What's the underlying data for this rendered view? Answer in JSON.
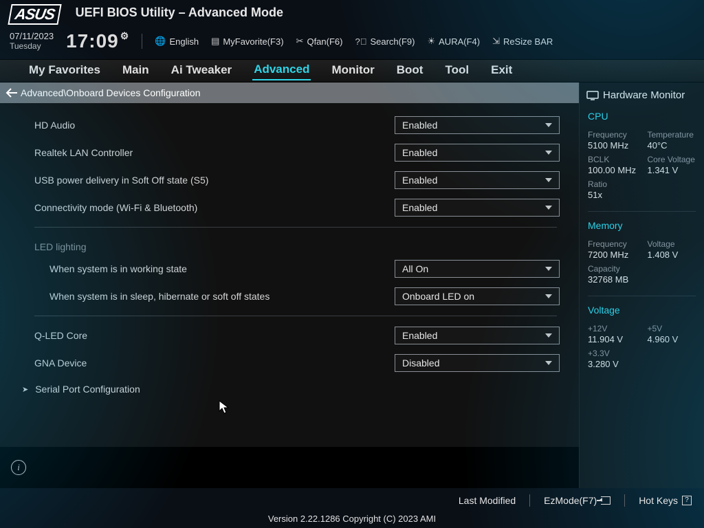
{
  "header": {
    "logo_text": "ASUS",
    "title": "UEFI BIOS Utility – Advanced Mode",
    "date": "07/11/2023",
    "day": "Tuesday",
    "time": "17:09",
    "toolbar": {
      "language": "English",
      "favorite": "MyFavorite(F3)",
      "qfan": "Qfan(F6)",
      "search": "Search(F9)",
      "aura": "AURA(F4)",
      "resize": "ReSize BAR"
    }
  },
  "tabs": [
    "My Favorites",
    "Main",
    "Ai Tweaker",
    "Advanced",
    "Monitor",
    "Boot",
    "Tool",
    "Exit"
  ],
  "active_tab_index": 3,
  "breadcrumb": "Advanced\\Onboard Devices Configuration",
  "settings": [
    {
      "label": "HD Audio",
      "value": "Enabled"
    },
    {
      "label": "Realtek LAN Controller",
      "value": "Enabled"
    },
    {
      "label": "USB power delivery in Soft Off state (S5)",
      "value": "Enabled"
    },
    {
      "label": "Connectivity mode (Wi-Fi & Bluetooth)",
      "value": "Enabled"
    }
  ],
  "led_section": {
    "title": "LED lighting",
    "rows": [
      {
        "label": "When system is in working state",
        "value": "All On"
      },
      {
        "label": "When system is in sleep, hibernate or soft off states",
        "value": "Onboard LED on"
      }
    ]
  },
  "settings2": [
    {
      "label": "Q-LED Core",
      "value": "Enabled"
    },
    {
      "label": "GNA Device",
      "value": "Disabled"
    }
  ],
  "expander": "Serial Port Configuration",
  "sidebar": {
    "title": "Hardware Monitor",
    "cpu": {
      "head": "CPU",
      "freq_k": "Frequency",
      "freq_v": "5100 MHz",
      "temp_k": "Temperature",
      "temp_v": "40°C",
      "bclk_k": "BCLK",
      "bclk_v": "100.00 MHz",
      "cv_k": "Core Voltage",
      "cv_v": "1.341 V",
      "ratio_k": "Ratio",
      "ratio_v": "51x"
    },
    "mem": {
      "head": "Memory",
      "freq_k": "Frequency",
      "freq_v": "7200 MHz",
      "volt_k": "Voltage",
      "volt_v": "1.408 V",
      "cap_k": "Capacity",
      "cap_v": "32768 MB"
    },
    "volt": {
      "head": "Voltage",
      "v12_k": "+12V",
      "v12_v": "11.904 V",
      "v5_k": "+5V",
      "v5_v": "4.960 V",
      "v33_k": "+3.3V",
      "v33_v": "3.280 V"
    }
  },
  "footer": {
    "last_modified": "Last Modified",
    "ezmode": "EzMode(F7)",
    "hotkeys": "Hot Keys",
    "version": "Version 2.22.1286 Copyright (C) 2023 AMI"
  }
}
